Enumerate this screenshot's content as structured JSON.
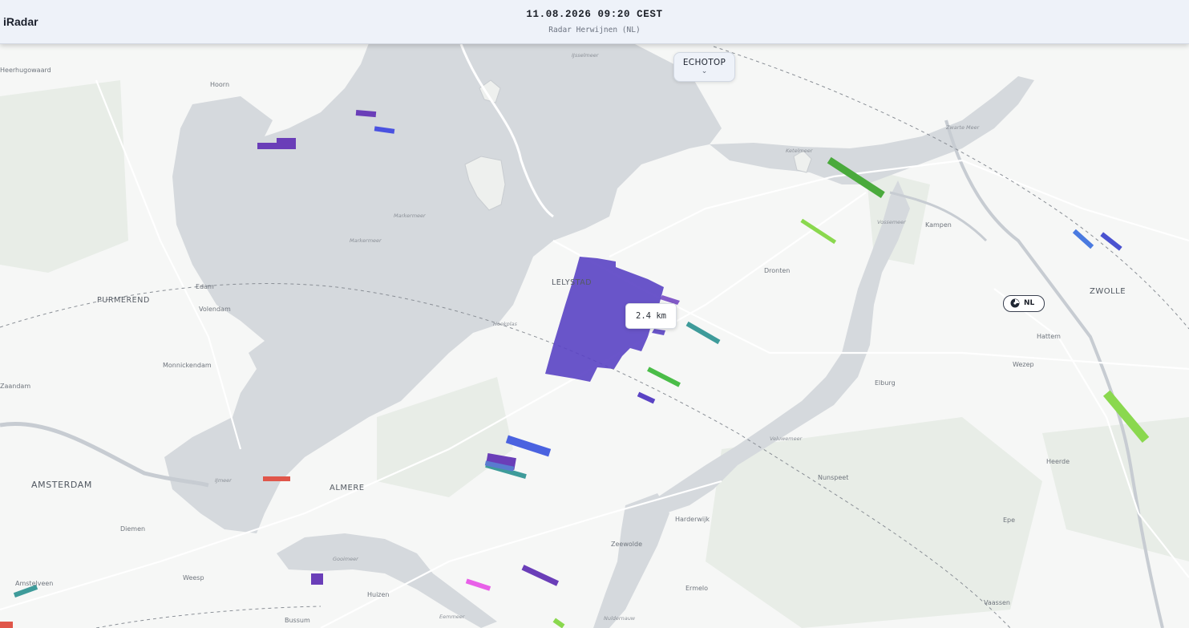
{
  "app": {
    "name": "iRadar"
  },
  "header": {
    "timestamp": "11.08.2026 09:20 CEST",
    "station": "Radar Herwijnen (NL)"
  },
  "layer_selector": {
    "label": "ECHOTOP",
    "icon": "chevron-down-icon"
  },
  "tooltip": {
    "value": "2.4 km"
  },
  "country_badge": {
    "label": "NL",
    "icon": "radar-icon"
  },
  "places": {
    "hoorn": "Hoorn",
    "edam": "Edam",
    "volendam": "Volendam",
    "purmerend": "PURMEREND",
    "monnickendam": "Monnickendam",
    "amsterdam": "AMSTERDAM",
    "diemen": "Diemen",
    "weesp": "Weesp",
    "amstelveen": "Amstelveen",
    "almere": "ALMERE",
    "huizen": "Huizen",
    "bussum": "Bussum",
    "lelystad": "LELYSTAD",
    "dronten": "Dronten",
    "kampen": "Kampen",
    "zwolle": "ZWOLLE",
    "hattem": "Hattem",
    "wezep": "Wezep",
    "elburg": "Elburg",
    "nunspeet": "Nunspeet",
    "harderwijk": "Harderwijk",
    "zeewolde": "Zeewolde",
    "ermelo": "Ermelo",
    "heerde": "Heerde",
    "epe": "Epe",
    "vaassen": "Vaassen",
    "hugowaard": "Heerhugowaard",
    "zaandam": "Zaandam"
  },
  "waters": {
    "ijsselmeer": "IJsselmeer",
    "markermeer": "Markermeer",
    "markermeer2": "Markermeer",
    "ketelmeer": "Ketelmeer",
    "zwartemeer": "Zwarte Meer",
    "vossemeer": "Vossemeer",
    "veluwemeer": "Veluwemeer",
    "ijmeer": "IJmeer",
    "gooimeer": "Gooimeer",
    "eemmeer": "Eemmeer",
    "nuldernauw": "Nuldernauw",
    "hoekplas": "Hoekplas"
  },
  "echotop_scale": {
    "low": "#e0564a",
    "green_light": "#8ad84e",
    "green": "#4aaa3c",
    "teal": "#3e9b9a",
    "blue": "#4a62e0",
    "violet": "#5a43c4",
    "purple": "#6a3eb8",
    "magenta": "#e860e8"
  }
}
